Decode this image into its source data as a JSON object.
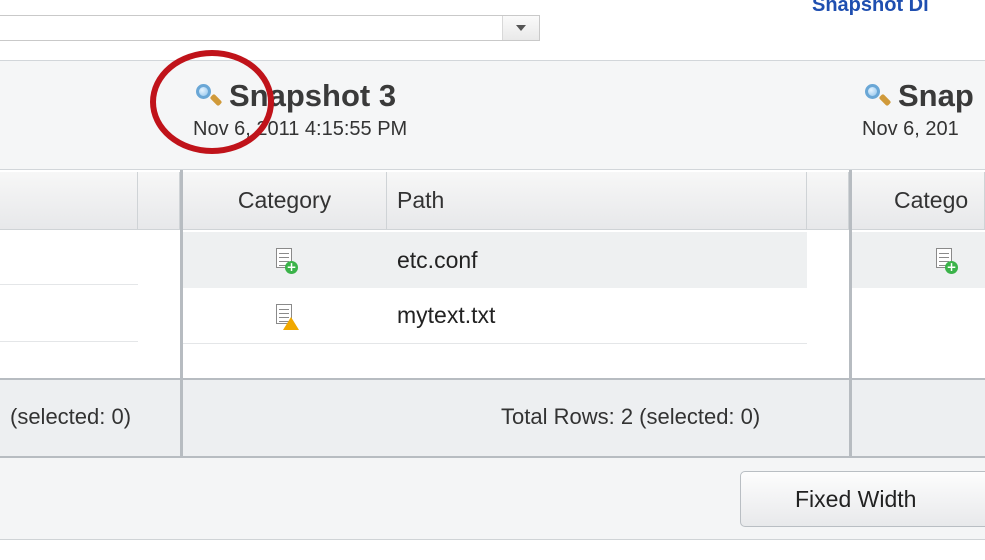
{
  "header": {
    "link_title": "Snapshot Di",
    "dropdown_value": ""
  },
  "snapshots": [
    {
      "title": "Snapshot 3",
      "date": "Nov 6, 2011 4:15:55 PM"
    },
    {
      "title": "Snap",
      "date": "Nov 6, 201"
    }
  ],
  "grid": {
    "columns": [
      "Category",
      "Path"
    ],
    "partial_column": "Catego",
    "rows": [
      {
        "category_icon": "file-added-icon",
        "path": "etc.conf"
      },
      {
        "category_icon": "file-warning-icon",
        "path": "mytext.txt"
      }
    ]
  },
  "footer": {
    "left_status": "(selected: 0)",
    "mid_status": "Total Rows: 2 (selected: 0)"
  },
  "buttons": {
    "fixed_width": "Fixed Width"
  },
  "colors": {
    "accent": "#1f4fb0",
    "highlight_circle": "#c0131a",
    "add_badge": "#3bb34a",
    "warn_badge": "#f0a800"
  }
}
